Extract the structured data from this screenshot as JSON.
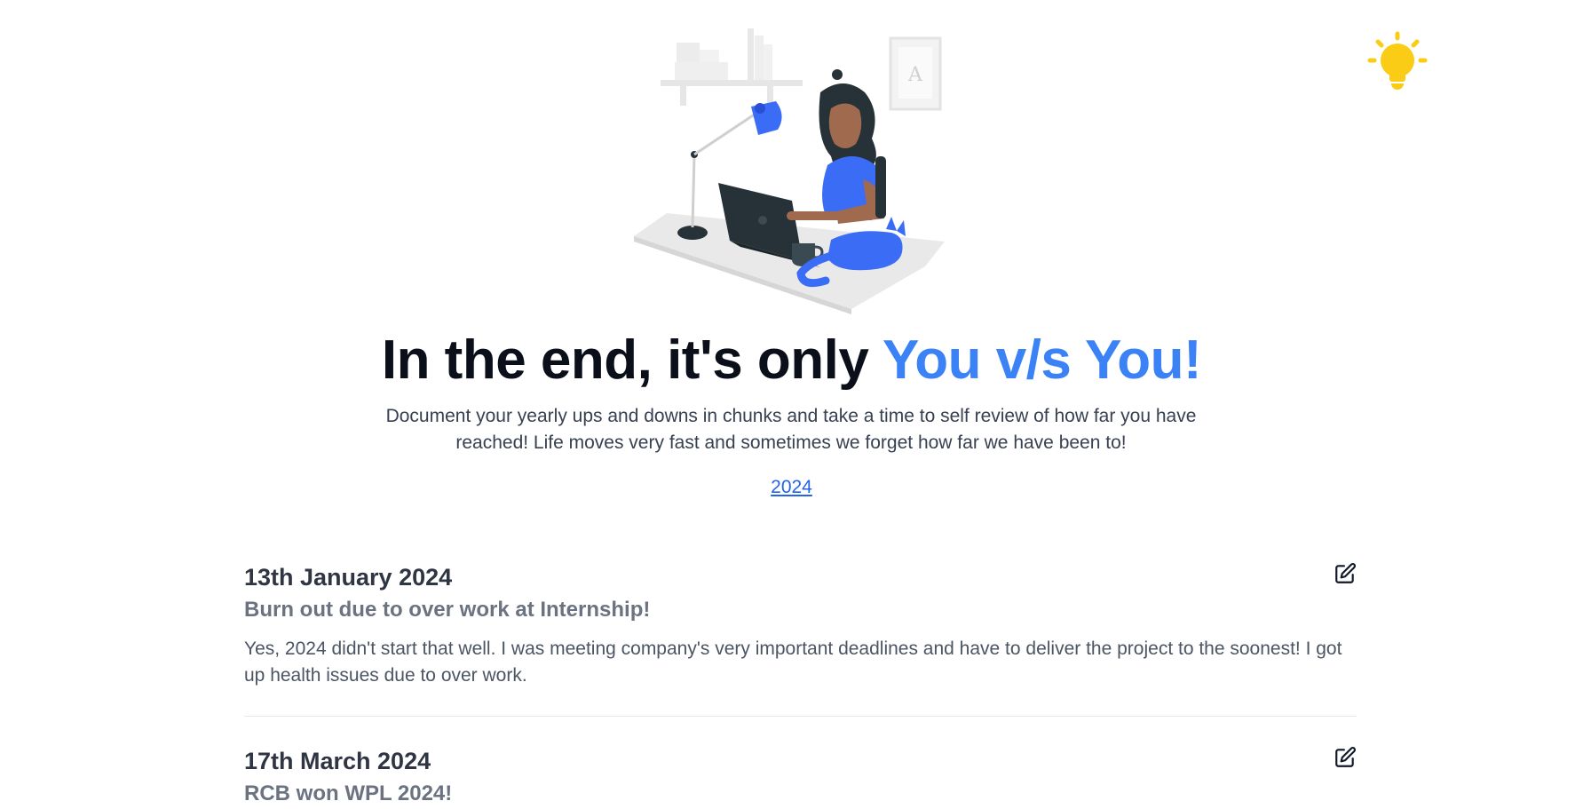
{
  "header": {
    "theme_toggle_icon": "lightbulb-icon",
    "theme_toggle_color": "#FACC15"
  },
  "hero": {
    "illustration": "woman-at-desk-with-laptop-and-cat-illustration",
    "title_prefix": "In the end, it's only",
    "title_accent": "You v/s You!",
    "accent_color": "#3B82F6",
    "subtitle": "Document your yearly ups and downs in chunks and take a time to self review of how far you have reached! Life moves very fast and sometimes we forget how far we have been to!",
    "year_link": "2024"
  },
  "entries": [
    {
      "date": "13th January 2024",
      "title": "Burn out due to over work at Internship!",
      "body": "Yes, 2024 didn't start that well. I was meeting company's very important deadlines and have to deliver the project to the soonest! I got up health issues due to over work.",
      "edit_icon": "edit-pencil-icon"
    },
    {
      "date": "17th March 2024",
      "title": "RCB won WPL 2024!",
      "body": "",
      "edit_icon": "edit-pencil-icon"
    }
  ]
}
